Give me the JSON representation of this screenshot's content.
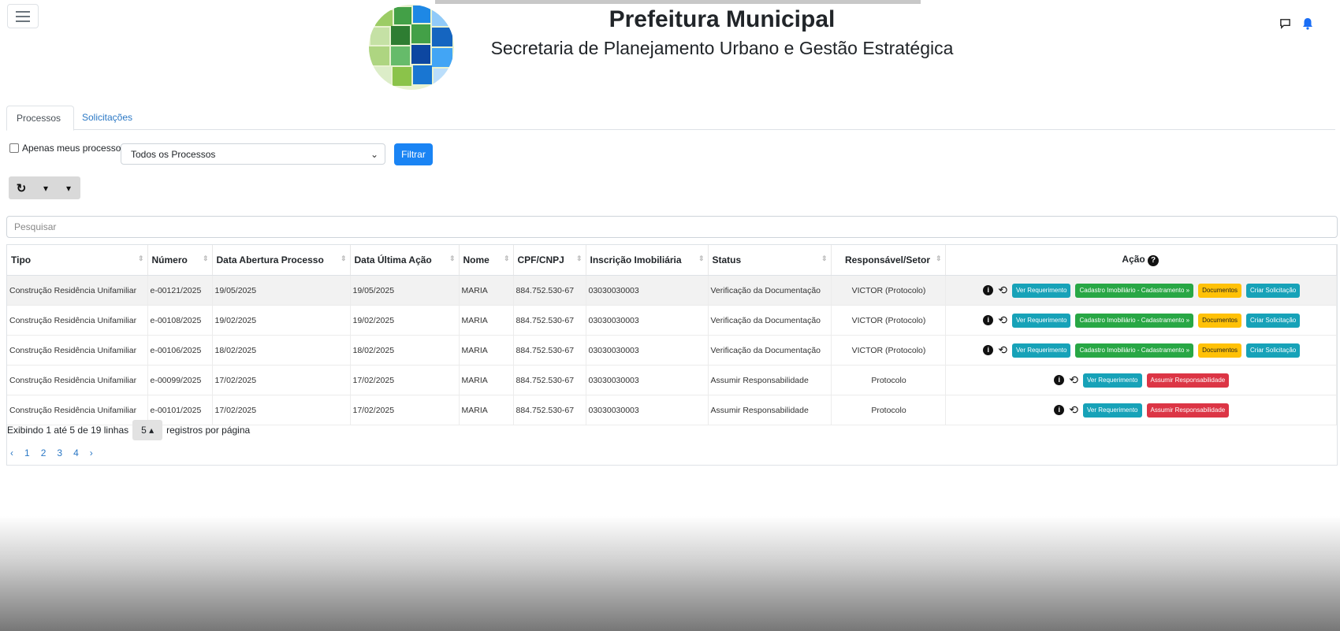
{
  "header": {
    "title": "Prefeitura Municipal",
    "subtitle": "Secretaria de Planejamento Urbano e Gestão Estratégica"
  },
  "tabs": [
    {
      "label": "Processos",
      "active": true
    },
    {
      "label": "Solicitações",
      "active": false
    }
  ],
  "filters": {
    "only_mine_label": "Apenas meus processos",
    "select_value": "Todos os Processos",
    "filter_button": "Filtrar"
  },
  "search": {
    "placeholder": "Pesquisar"
  },
  "table": {
    "columns": [
      "Tipo",
      "Número",
      "Data Abertura Processo",
      "Data Última Ação",
      "Nome",
      "CPF/CNPJ",
      "Inscrição Imobiliária",
      "Status",
      "Responsável/Setor",
      "Ação"
    ],
    "rows": [
      {
        "tipo": "Construção Residência Unifamiliar",
        "numero": "e-00121/2025",
        "abertura": "19/05/2025",
        "ultima": "19/05/2025",
        "nome": "MARIA",
        "cpf": "884.752.530-67",
        "inscricao": "03030030003",
        "status": "Verificação da Documentação",
        "responsavel": "VICTOR (Protocolo)",
        "actions": "full"
      },
      {
        "tipo": "Construção Residência Unifamiliar",
        "numero": "e-00108/2025",
        "abertura": "19/02/2025",
        "ultima": "19/02/2025",
        "nome": "MARIA",
        "cpf": "884.752.530-67",
        "inscricao": "03030030003",
        "status": "Verificação da Documentação",
        "responsavel": "VICTOR (Protocolo)",
        "actions": "full"
      },
      {
        "tipo": "Construção Residência Unifamiliar",
        "numero": "e-00106/2025",
        "abertura": "18/02/2025",
        "ultima": "18/02/2025",
        "nome": "MARIA",
        "cpf": "884.752.530-67",
        "inscricao": "03030030003",
        "status": "Verificação da Documentação",
        "responsavel": "VICTOR (Protocolo)",
        "actions": "full"
      },
      {
        "tipo": "Construção Residência Unifamiliar",
        "numero": "e-00099/2025",
        "abertura": "17/02/2025",
        "ultima": "17/02/2025",
        "nome": "MARIA",
        "cpf": "884.752.530-67",
        "inscricao": "03030030003",
        "status": "Assumir Responsabilidade",
        "responsavel": "Protocolo",
        "actions": "assume"
      },
      {
        "tipo": "Construção Residência Unifamiliar",
        "numero": "e-00101/2025",
        "abertura": "17/02/2025",
        "ultima": "17/02/2025",
        "nome": "MARIA",
        "cpf": "884.752.530-67",
        "inscricao": "03030030003",
        "status": "Assumir Responsabilidade",
        "responsavel": "Protocolo",
        "actions": "assume"
      }
    ],
    "action_labels": {
      "ver": "Ver Requerimento",
      "cadastro": "Cadastro Imobiliário - Cadastramento »",
      "documentos": "Documentos",
      "criar": "Criar Solicitação",
      "assumir": "Assumir Responsabilidade"
    }
  },
  "footer": {
    "showing_text": "Exibindo 1 até 5 de 19 linhas",
    "per_page_value": "5",
    "per_page_suffix": "registros por página",
    "pages": [
      "‹",
      "1",
      "2",
      "3",
      "4",
      "›"
    ]
  },
  "colors": {
    "primary": "#1a84f4",
    "info": "#17a2b8",
    "success": "#28a745",
    "warning": "#ffc107",
    "danger": "#dc3545"
  }
}
